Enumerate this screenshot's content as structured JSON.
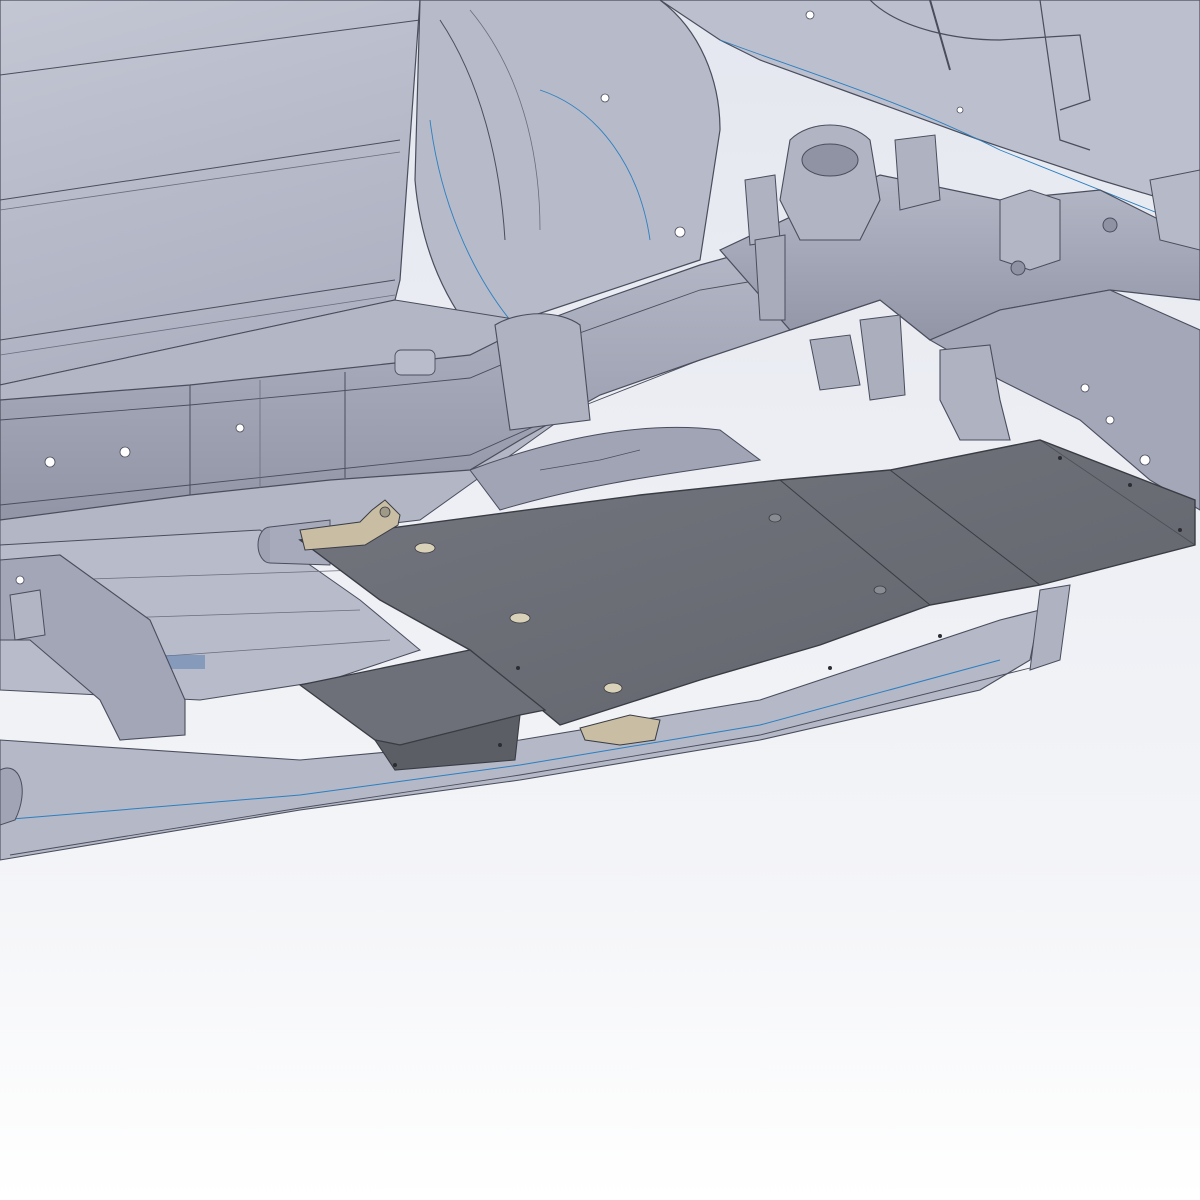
{
  "scene": {
    "view": "cad-3d-render",
    "subject": "vehicle-underbody-frame-with-skid-plate",
    "background_colors": {
      "top": "#e4e7ef",
      "bottom": "#ffffff"
    },
    "colors": {
      "body_panel": "#b8bccb",
      "body_panel_light": "#c6c9d6",
      "body_panel_dark": "#9ea2b3",
      "frame_rail": "#a6aabb",
      "frame_rail_shadow": "#8e92a3",
      "edge_line": "#4a4d5c",
      "curve_accent": "#2b7fc0",
      "skid_plate": "#6b6d76",
      "skid_plate_dark": "#5c5e66",
      "skid_plate_light": "#7a7c85",
      "bracket_tan": "#c9bea3",
      "hole": "#d9d2b8"
    }
  }
}
